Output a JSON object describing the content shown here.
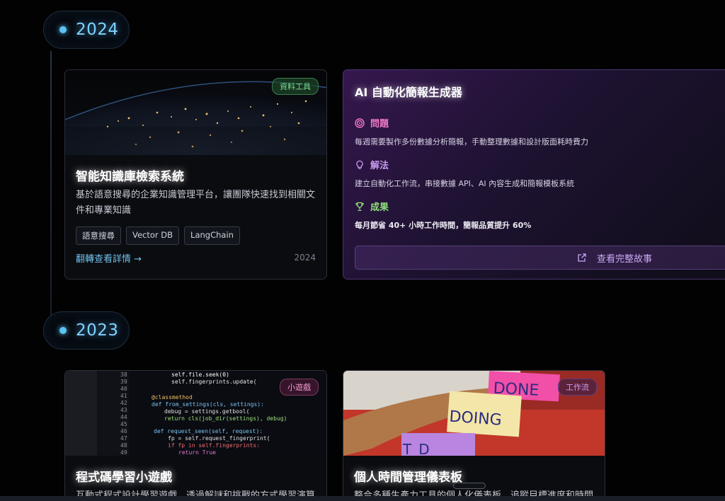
{
  "timeline": [
    {
      "year": "2024"
    },
    {
      "year": "2023"
    }
  ],
  "card_kb": {
    "badge": "資料工具",
    "title": "智能知識庫檢索系統",
    "desc": "基於語意搜尋的企業知識管理平台，讓團隊快速找到相關文件和專業知識",
    "tags": [
      "語意搜尋",
      "Vector DB",
      "LangChain"
    ],
    "link": "翻轉查看詳情 →",
    "year": "2024"
  },
  "card_report": {
    "title": "AI 自動化簡報生成器",
    "problem_label": "問題",
    "problem_text": "每週需要製作多份數據分析簡報，手動整理數據和設計版面耗時費力",
    "solution_label": "解法",
    "solution_text": "建立自動化工作流，串接數據 API、AI 內容生成和簡報模板系統",
    "result_label": "成果",
    "result_text": "每月節省 40+ 小時工作時間，簡報品質提升 60%",
    "button": "查看完整故事",
    "colors": {
      "problem": "#f07ac8",
      "solution": "#c89af0",
      "result": "#8ee07a"
    }
  },
  "card_game": {
    "badge": "小遊戲",
    "title": "程式碼學習小遊戲",
    "desc": "互動式程式設計學習遊戲，透過解謎和挑戰的方式學習演算"
  },
  "card_dash": {
    "badge": "工作流",
    "title": "個人時間管理儀表板",
    "desc": "整合多種生產力工具的個人化儀表板，追蹤目標進度和時間"
  },
  "icons": {
    "problem": "target-icon",
    "solution": "lightbulb-icon",
    "result": "trophy-icon",
    "button": "external-link-icon",
    "ai": "ai-logo-icon"
  }
}
